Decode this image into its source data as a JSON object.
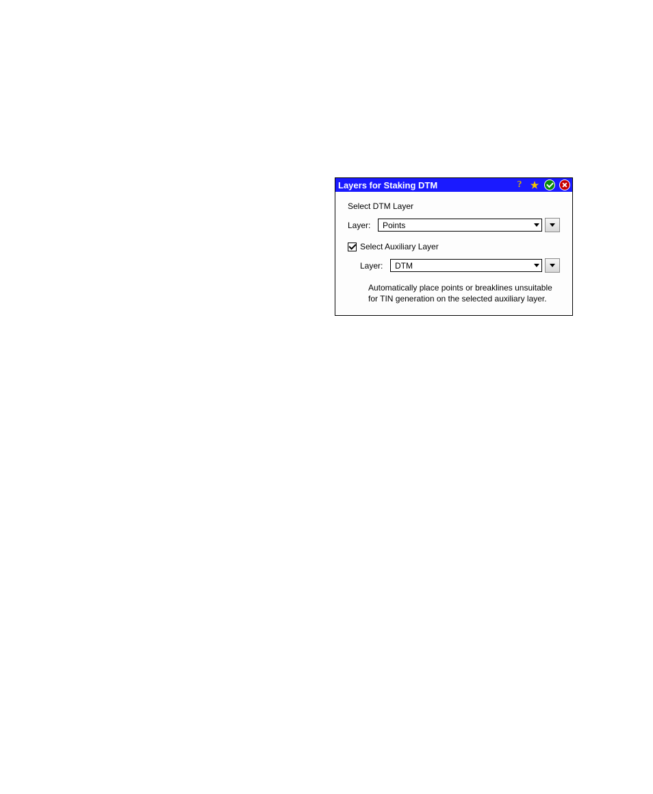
{
  "dialog": {
    "title": "Layers for Staking DTM",
    "dtm": {
      "section_label": "Select DTM Layer",
      "layer_label": "Layer:",
      "layer_value": "Points"
    },
    "aux": {
      "checkbox_label": "Select Auxiliary Layer",
      "checked": true,
      "layer_label": "Layer:",
      "layer_value": "DTM",
      "help_text": "Automatically place points or breaklines unsuitable for TIN generation on the selected auxiliary layer."
    },
    "icons": {
      "help": "?",
      "star": "★"
    }
  }
}
